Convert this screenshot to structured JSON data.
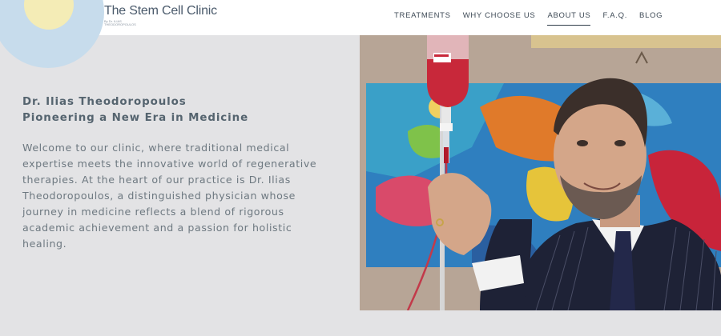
{
  "header": {
    "logo": {
      "title": "The Stem Cell Clinic",
      "subtitle_line1": "By Dr. ILIAS",
      "subtitle_line2": "THEODOROPOULOS"
    },
    "nav": [
      {
        "label": "TREATMENTS",
        "active": false
      },
      {
        "label": "WHY CHOOSE US",
        "active": false
      },
      {
        "label": "ABOUT US",
        "active": true
      },
      {
        "label": "F.A.Q.",
        "active": false
      },
      {
        "label": "BLOG",
        "active": false
      }
    ]
  },
  "hero": {
    "heading_line1": "Dr. Ilias Theodoropoulos",
    "heading_line2": "Pioneering a New Era in Medicine",
    "body_lines": [
      "Welcome to our clinic, where traditional medical",
      "expertise meets the innovative world of regenerative",
      "therapies. At the heart of our practice is Dr. Ilias",
      "Theodoropoulos, a distinguished physician whose",
      "journey in medicine reflects a blend of rigorous",
      "academic achievement and a passion for holistic",
      "healing."
    ]
  },
  "colors": {
    "background": "#e3e3e5",
    "heading": "#55646f",
    "body": "#6d7880",
    "circle_blue": "#c7dcec",
    "circle_yellow": "#f4ecb6"
  }
}
